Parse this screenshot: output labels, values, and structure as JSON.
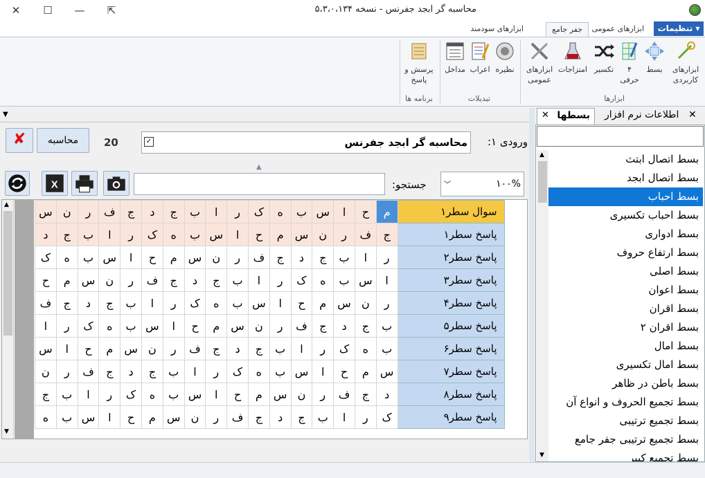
{
  "window": {
    "title": "محاسبه گر ابجد جفرنس - نسخه ۵،۳،۰،۱۳۴",
    "min_glyph": "—",
    "max_glyph": "☐",
    "close_glyph": "✕",
    "restore_glyph": "⇱"
  },
  "ribbon_tabs": {
    "settings": "تنظیمات",
    "general": "ابزارهای عمومی",
    "jafr": "جفر جامع",
    "useful": "ابزارهای سودمند"
  },
  "ribbon": {
    "tools_group": "ابزارها",
    "conversions_group": "تبدیلات",
    "programs_group": "برنامه ها",
    "buttons": {
      "user_tools": "ابزارهای کاربردی",
      "bast": "بسط",
      "four_letter": "۴ حرفی",
      "taksir": "تکسیر",
      "emtezajat": "امتزاجات",
      "general_tools": "ابزارهای عمومی",
      "nazireh": "نظیره",
      "erab": "اعراب",
      "madakhel": "مداخل",
      "qa": "پرسش و پاسخ"
    }
  },
  "right_panel": {
    "tab_active": "بسطها",
    "tab_other": "اطلاعات نرم افزار",
    "items": [
      "بسط اتصال ابتث",
      "بسط اتصال ابجد",
      "بسط احباب",
      "بسط احباب تکسیری",
      "بسط ادواری",
      "بسط ارتفاع حروف",
      "بسط اصلی",
      "بسط اعوان",
      "بسط اقران",
      "بسط اقران ۲",
      "بسط امال",
      "بسط امال تکسیری",
      "بسط باطن در ظاهر",
      "بسط تجمیع الحروف و انواع آن",
      "بسط تجمیع ترتیبی",
      "بسط تجمیع ترتیبی جفر جامع",
      "بسط تجمیع کبیر"
    ],
    "selected_index": 2
  },
  "input": {
    "label": "ورودی ۱:",
    "value": "محاسبه گر ابجد جفرنس",
    "count": "20",
    "calc_button": "محاسبه"
  },
  "search": {
    "label": "جستجو:",
    "value": "",
    "zoom": "۱۰۰%"
  },
  "grid": {
    "headers": [
      "سوال سطر۱",
      "پاسخ سطر۱",
      "پاسخ سطر۲",
      "پاسخ سطر۳",
      "پاسخ سطر۴",
      "پاسخ سطر۵",
      "پاسخ سطر۶",
      "پاسخ سطر۷",
      "پاسخ سطر۸",
      "پاسخ سطر۹"
    ],
    "rows": [
      [
        "م",
        "ح",
        "ا",
        "س",
        "ب",
        "ه",
        "ک",
        "ر",
        "ا",
        "ب",
        "ج",
        "د",
        "ج",
        "ف",
        "ر",
        "ن",
        "س"
      ],
      [
        "ج",
        "ف",
        "ر",
        "ن",
        "س",
        "م",
        "ح",
        "ا",
        "س",
        "ب",
        "ه",
        "ک",
        "ر",
        "ا",
        "ب",
        "ج",
        "د"
      ],
      [
        "ر",
        "ا",
        "ب",
        "ج",
        "د",
        "ج",
        "ف",
        "ر",
        "ن",
        "س",
        "م",
        "ح",
        "ا",
        "س",
        "ب",
        "ه",
        "ک"
      ],
      [
        "ا",
        "س",
        "ب",
        "ه",
        "ک",
        "ر",
        "ا",
        "ب",
        "ج",
        "د",
        "ج",
        "ف",
        "ر",
        "ن",
        "س",
        "م",
        "ح"
      ],
      [
        "ر",
        "ن",
        "س",
        "م",
        "ح",
        "ا",
        "س",
        "ب",
        "ه",
        "ک",
        "ر",
        "ا",
        "ب",
        "ج",
        "د",
        "ج",
        "ف"
      ],
      [
        "ب",
        "ج",
        "د",
        "ج",
        "ف",
        "ر",
        "ن",
        "س",
        "م",
        "ح",
        "ا",
        "س",
        "ب",
        "ه",
        "ک",
        "ر",
        "ا"
      ],
      [
        "ب",
        "ه",
        "ک",
        "ر",
        "ا",
        "ب",
        "ج",
        "د",
        "ج",
        "ف",
        "ر",
        "ن",
        "س",
        "م",
        "ح",
        "ا",
        "س"
      ],
      [
        "س",
        "م",
        "ح",
        "ا",
        "س",
        "ب",
        "ه",
        "ک",
        "ر",
        "ا",
        "ب",
        "ج",
        "د",
        "ج",
        "ف",
        "ر",
        "ن"
      ],
      [
        "د",
        "ج",
        "ف",
        "ر",
        "ن",
        "س",
        "م",
        "ح",
        "ا",
        "س",
        "ب",
        "ه",
        "ک",
        "ر",
        "ا",
        "ب",
        "ج"
      ],
      [
        "ک",
        "ر",
        "ا",
        "ب",
        "ج",
        "د",
        "ج",
        "ف",
        "ر",
        "ن",
        "س",
        "م",
        "ح",
        "ا",
        "س",
        "ب",
        "ه"
      ]
    ]
  },
  "colors": {
    "accent": "#2b64b6",
    "selection": "#0f78d7",
    "grid_header": "#c4d9f1",
    "grid_header_active": "#f6c743",
    "pink_row": "#fae5dc"
  }
}
